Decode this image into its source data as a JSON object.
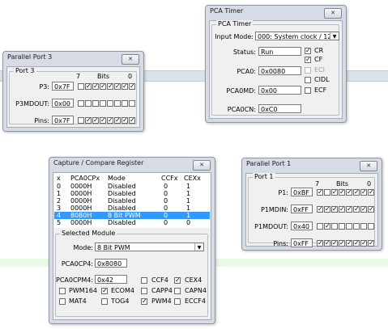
{
  "port3": {
    "window_title": "Parallel Port 3",
    "group": "Port 3",
    "bits_high": "7",
    "bits_label": "Bits",
    "bits_low": "0",
    "p3_label": "P3:",
    "p3_value": "0x7F",
    "p3_bits": [
      false,
      true,
      true,
      true,
      true,
      true,
      true,
      true
    ],
    "dout_label": "P3MDOUT:",
    "dout_value": "0x00",
    "dout_bits": [
      false,
      false,
      false,
      false,
      false,
      false,
      false,
      false
    ],
    "pins_label": "Pins:",
    "pins_value": "0x7F",
    "pins_bits": [
      false,
      true,
      true,
      true,
      true,
      true,
      true,
      true
    ]
  },
  "pca_timer": {
    "window_title": "PCA Timer",
    "group": "PCA Timer",
    "input_mode_label": "Input Mode:",
    "input_mode_value": "000: System clock / 12",
    "status_label": "Status:",
    "status_value": "Run",
    "pca0_label": "PCA0:",
    "pca0_value": "0x0080",
    "pca0md_label": "PCA0MD:",
    "pca0md_value": "0x00",
    "pca0cn_label": "PCA0CN:",
    "pca0cn_value": "0xC0",
    "cr_label": "CR",
    "cr_checked": true,
    "cf_label": "CF",
    "cf_checked": true,
    "eci_label": "ECI",
    "eci_checked": false,
    "cidl_label": "CIDL",
    "cidl_checked": false,
    "ecf_label": "ECF",
    "ecf_checked": false
  },
  "ccr": {
    "window_title": "Capture / Compare Register",
    "columns": [
      "x",
      "PCA0CPx",
      "Mode",
      "CCFx",
      "CEXx"
    ],
    "rows": [
      [
        "0",
        "0000H",
        "Disabled",
        "0",
        "1"
      ],
      [
        "1",
        "0000H",
        "Disabled",
        "0",
        "1"
      ],
      [
        "2",
        "0000H",
        "Disabled",
        "0",
        "1"
      ],
      [
        "3",
        "0000H",
        "Disabled",
        "0",
        "1"
      ],
      [
        "4",
        "8080H",
        "8 Bit PWM",
        "0",
        "1"
      ],
      [
        "5",
        "0000H",
        "Disabled",
        "0",
        "0"
      ]
    ],
    "selected_row": 4,
    "group": "Selected Module",
    "mode_label": "Mode:",
    "mode_value": "8 Bit PWM",
    "pca0cp4_label": "PCA0CP4:",
    "pca0cp4_value": "0x8080",
    "pca0cpm4_label": "PCA0CPM4:",
    "pca0cpm4_value": "0x42",
    "ccf4_label": "CCF4",
    "ccf4_checked": false,
    "cex4_label": "CEX4",
    "cex4_checked": true,
    "pwm164_label": "PWM164",
    "pwm164_checked": false,
    "ecom4_label": "ECOM4",
    "ecom4_checked": true,
    "capp4_label": "CAPP4",
    "capp4_checked": false,
    "capn4_label": "CAPN4",
    "capn4_checked": false,
    "mat4_label": "MAT4",
    "mat4_checked": false,
    "tog4_label": "TOG4",
    "tog4_checked": false,
    "pwm4_label": "PWM4",
    "pwm4_checked": true,
    "eccf4_label": "ECCF4",
    "eccf4_checked": false
  },
  "port1": {
    "window_title": "Parallel Port 1",
    "group": "Port 1",
    "bits_high": "7",
    "bits_label": "Bits",
    "bits_low": "0",
    "p1_label": "P1:",
    "p1_value": "0xBF",
    "p1_bits": [
      true,
      false,
      true,
      true,
      true,
      true,
      true,
      true
    ],
    "mdin_label": "P1MDIN:",
    "mdin_value": "0xFF",
    "mdin_bits": [
      true,
      true,
      true,
      true,
      true,
      true,
      true,
      true
    ],
    "mdout_label": "P1MDOUT:",
    "mdout_value": "0x40",
    "mdout_bits": [
      false,
      true,
      false,
      false,
      false,
      false,
      false,
      false
    ],
    "pins_label": "Pins:",
    "pins_value": "0xFF",
    "pins_bits": [
      true,
      true,
      true,
      true,
      true,
      true,
      true,
      true
    ]
  },
  "icons": {
    "close": "close-icon",
    "dropdown": "chevron-down-icon"
  },
  "colors": {
    "window_frame": "#d6dbe5",
    "panel": "#f0f0f0",
    "selection": "#3399ff",
    "connector_line": "#dde2ea",
    "canvas_band": "#e8fbe4"
  }
}
